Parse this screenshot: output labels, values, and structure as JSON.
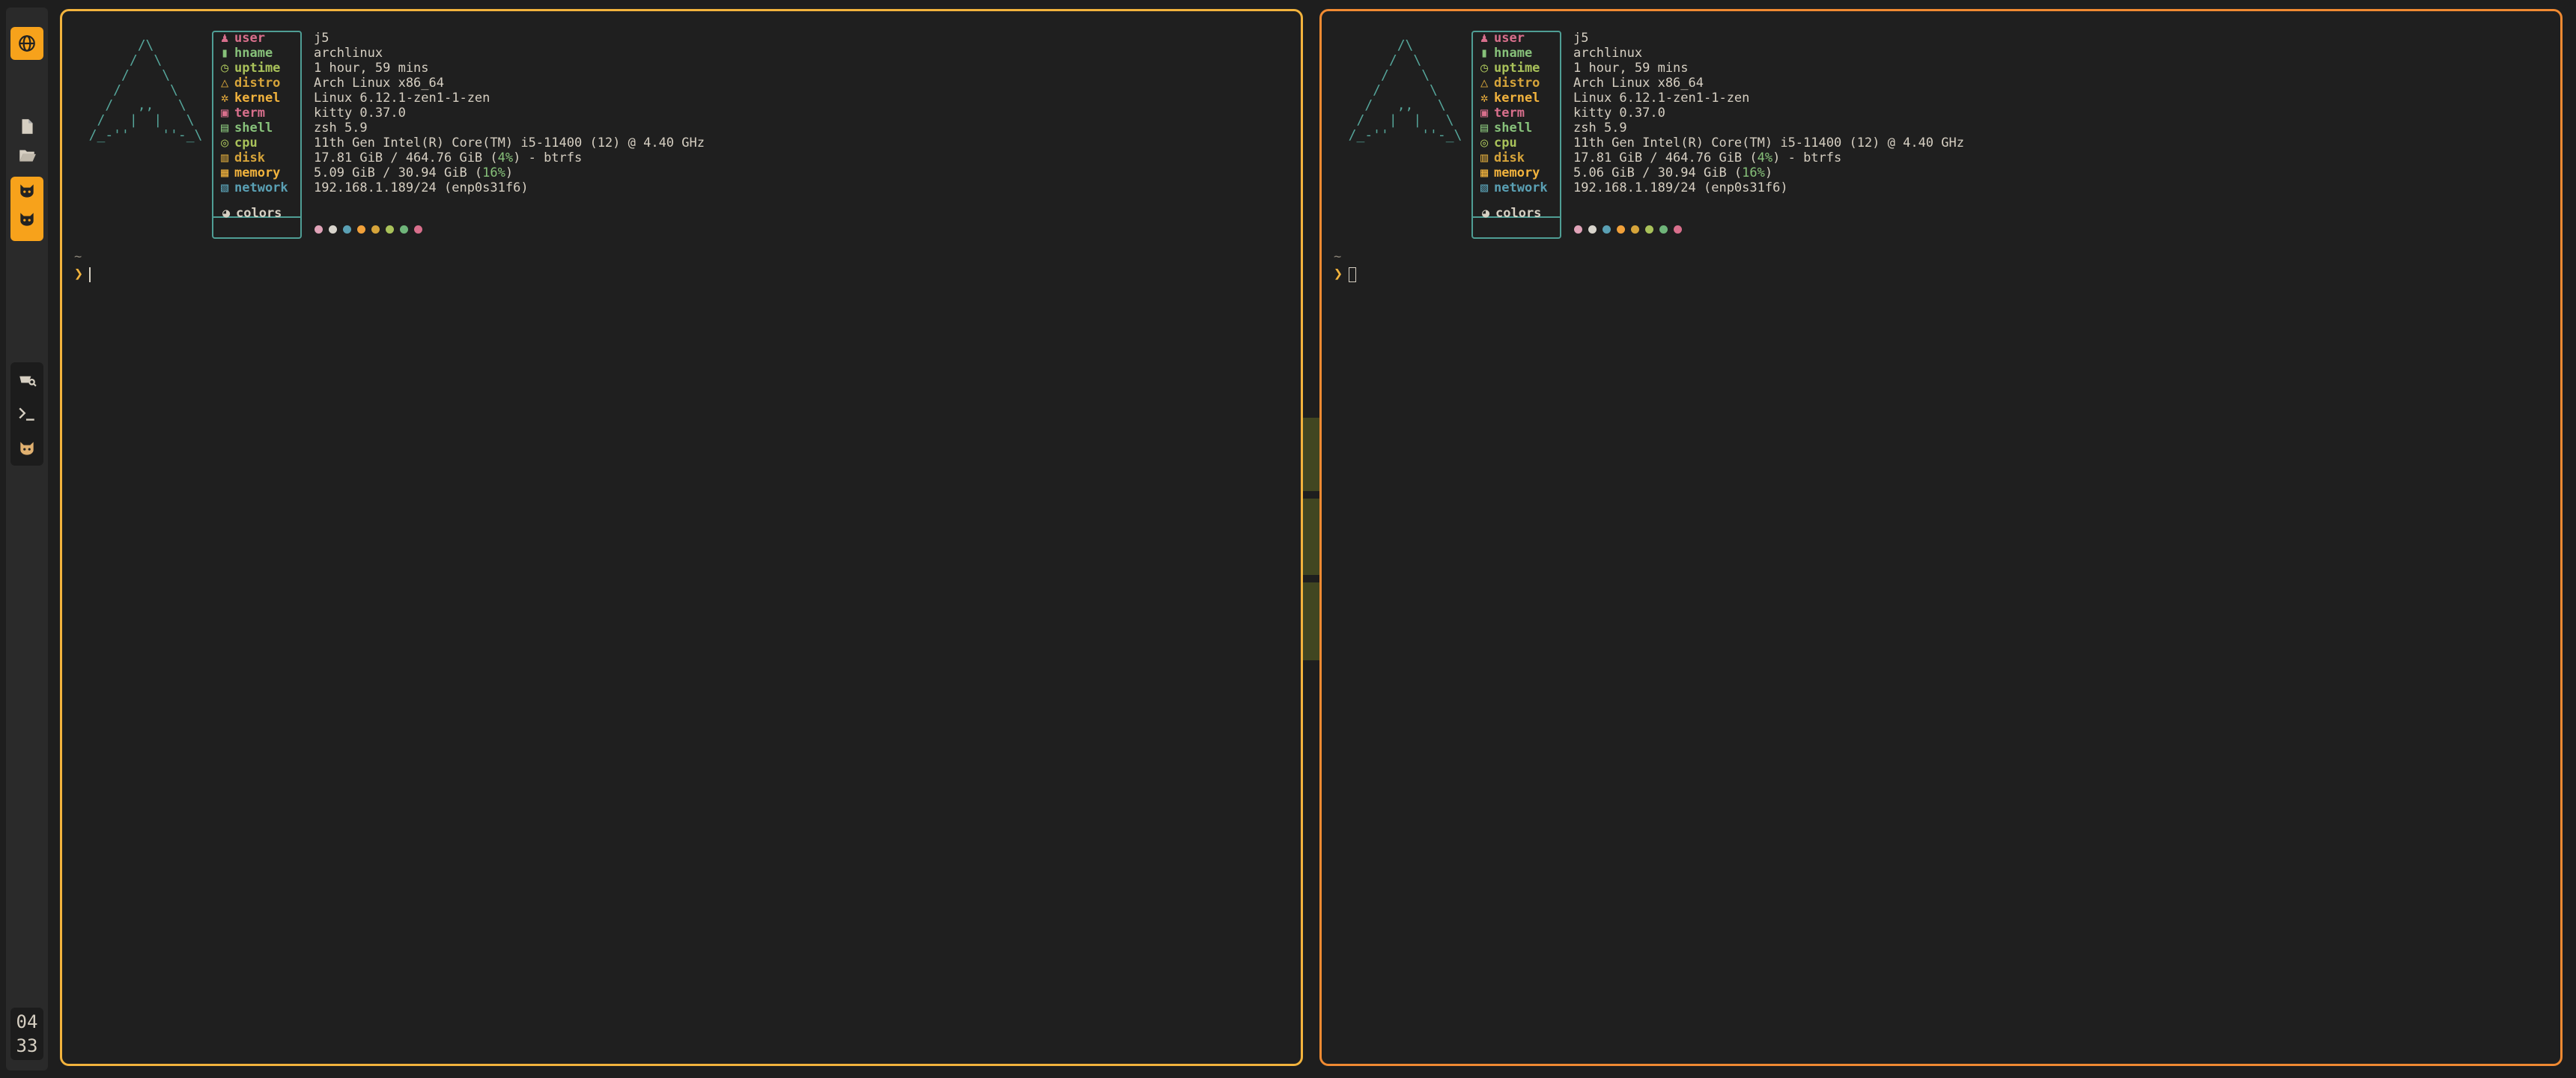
{
  "bar": {
    "top_icon": "globe-icon",
    "launcher_icons": [
      "file-icon",
      "folder-open-icon"
    ],
    "active_tags": [
      "cat-icon",
      "cat-icon"
    ],
    "apps": [
      "screenshot-tool-icon",
      "terminal-icon",
      "cat-icon"
    ],
    "accent": "#f7a21b",
    "clock": {
      "hour": "04",
      "minute": "33"
    }
  },
  "panes": [
    {
      "border_color": "#f2b33d",
      "info": [
        {
          "label": "user",
          "value": "j5",
          "color": "#d86f8c",
          "icon": "person-icon"
        },
        {
          "label": "hname",
          "value": "archlinux",
          "color": "#87c17a",
          "icon": "battery-icon"
        },
        {
          "label": "uptime",
          "value": "1 hour, 59 mins",
          "color": "#a9c25a",
          "icon": "clock-icon"
        },
        {
          "label": "distro",
          "value": "Arch Linux x86_64",
          "color": "#d6a43a",
          "icon": "triangle-icon"
        },
        {
          "label": "kernel",
          "value": "Linux 6.12.1-zen1-1-zen",
          "color": "#f2b33d",
          "icon": "gear-icon"
        },
        {
          "label": "term",
          "value": "kitty 0.37.0",
          "color": "#d86f8c",
          "icon": "terminal-box-icon"
        },
        {
          "label": "shell",
          "value": "zsh 5.9",
          "color": "#87c17a",
          "icon": "shell-icon"
        },
        {
          "label": "cpu",
          "value": "11th Gen Intel(R) Core(TM) i5-11400 (12) @ 4.40 GHz",
          "color": "#a9c25a",
          "icon": "cpu-icon"
        },
        {
          "label": "disk",
          "value_pre": "17.81 GiB / 464.76 GiB (",
          "pct": "4%",
          "value_post": ") - btrfs",
          "color": "#d6a43a",
          "icon": "disk-icon"
        },
        {
          "label": "memory",
          "value_pre": "5.09 GiB / 30.94 GiB (",
          "pct": "16%",
          "value_post": ")",
          "color": "#f2b33d",
          "icon": "memory-icon"
        },
        {
          "label": "network",
          "value": "192.168.1.189/24 (enp0s31f6)",
          "color": "#5aa0b4",
          "icon": "network-icon"
        }
      ],
      "colors_label": "colors",
      "tilde": "~",
      "prompt": "❯"
    },
    {
      "border_color": "#f08a32",
      "info": [
        {
          "label": "user",
          "value": "j5",
          "color": "#d86f8c",
          "icon": "person-icon"
        },
        {
          "label": "hname",
          "value": "archlinux",
          "color": "#87c17a",
          "icon": "battery-icon"
        },
        {
          "label": "uptime",
          "value": "1 hour, 59 mins",
          "color": "#a9c25a",
          "icon": "clock-icon"
        },
        {
          "label": "distro",
          "value": "Arch Linux x86_64",
          "color": "#d6a43a",
          "icon": "triangle-icon"
        },
        {
          "label": "kernel",
          "value": "Linux 6.12.1-zen1-1-zen",
          "color": "#f2b33d",
          "icon": "gear-icon"
        },
        {
          "label": "term",
          "value": "kitty 0.37.0",
          "color": "#d86f8c",
          "icon": "terminal-box-icon"
        },
        {
          "label": "shell",
          "value": "zsh 5.9",
          "color": "#87c17a",
          "icon": "shell-icon"
        },
        {
          "label": "cpu",
          "value": "11th Gen Intel(R) Core(TM) i5-11400 (12) @ 4.40 GHz",
          "color": "#a9c25a",
          "icon": "cpu-icon"
        },
        {
          "label": "disk",
          "value_pre": "17.81 GiB / 464.76 GiB (",
          "pct": "4%",
          "value_post": ") - btrfs",
          "color": "#d6a43a",
          "icon": "disk-icon"
        },
        {
          "label": "memory",
          "value_pre": "5.06 GiB / 30.94 GiB (",
          "pct": "16%",
          "value_post": ")",
          "color": "#f2b33d",
          "icon": "memory-icon"
        },
        {
          "label": "network",
          "value": "192.168.1.189/24 (enp0s31f6)",
          "color": "#5aa0b4",
          "icon": "network-icon"
        }
      ],
      "colors_label": "colors",
      "tilde": "~",
      "prompt": "❯"
    }
  ],
  "palette": [
    "#e0a3b8",
    "#d8d4cc",
    "#5aa0b4",
    "#f2a13a",
    "#d6a43a",
    "#a9c25a",
    "#6fb57a",
    "#d86f8c"
  ],
  "wallpaper": {
    "logo": "awesome-wm-logo",
    "letter_colors": [
      "#5a1d1d",
      "#57301a",
      "#574620",
      "#414621",
      "#334532",
      "#253d40",
      "#4a2e38"
    ]
  }
}
